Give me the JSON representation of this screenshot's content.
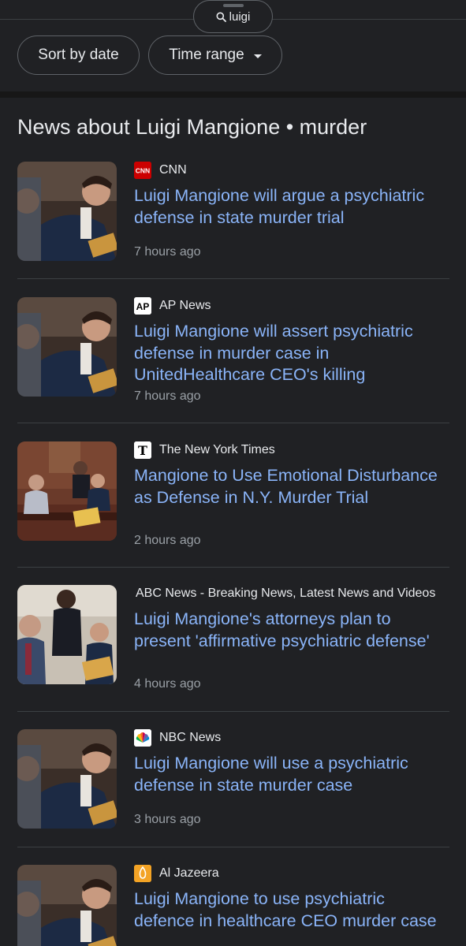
{
  "search": {
    "query": "luigi"
  },
  "filters": {
    "sort_label": "Sort by date",
    "time_label": "Time range"
  },
  "section": {
    "title": "News about Luigi Mangione • murder"
  },
  "articles": [
    {
      "source": "CNN",
      "headline": "Luigi Mangione will argue a psychiatric defense in state murder trial",
      "time": "7 hours ago",
      "logo": "cnn-logo-icon",
      "thumb": "courtroom-photo"
    },
    {
      "source": "AP News",
      "headline": "Luigi Mangione will assert psychiatric defense in murder case in UnitedHealthcare CEO's killing",
      "time": "7 hours ago",
      "logo": "ap-logo-icon",
      "thumb": "courtroom-photo"
    },
    {
      "source": "The New York Times",
      "headline": "Mangione to Use Emotional Disturbance as Defense in N.Y. Murder Trial",
      "time": "2 hours ago",
      "logo": "nyt-logo-icon",
      "thumb": "courtroom-wide-photo"
    },
    {
      "source": "ABC News - Breaking News, Latest News and Videos",
      "headline": "Luigi Mangione's attorneys plan to present 'affirmative psychiatric defense'",
      "time": "4 hours ago",
      "logo": "",
      "thumb": "courtroom-officer-photo"
    },
    {
      "source": "NBC News",
      "headline": "Luigi Mangione will use a psychiatric defense in state murder case",
      "time": "3 hours ago",
      "logo": "nbc-peacock-icon",
      "thumb": "courtroom-photo"
    },
    {
      "source": "Al Jazeera",
      "headline": "Luigi Mangione to use psychiatric defence in healthcare CEO murder case",
      "time": "",
      "logo": "al-jazeera-logo-icon",
      "thumb": "courtroom-photo"
    }
  ],
  "colors": {
    "background": "#202124",
    "link": "#8ab4f8",
    "meta": "#9aa0a6",
    "divider": "#3c4043"
  }
}
